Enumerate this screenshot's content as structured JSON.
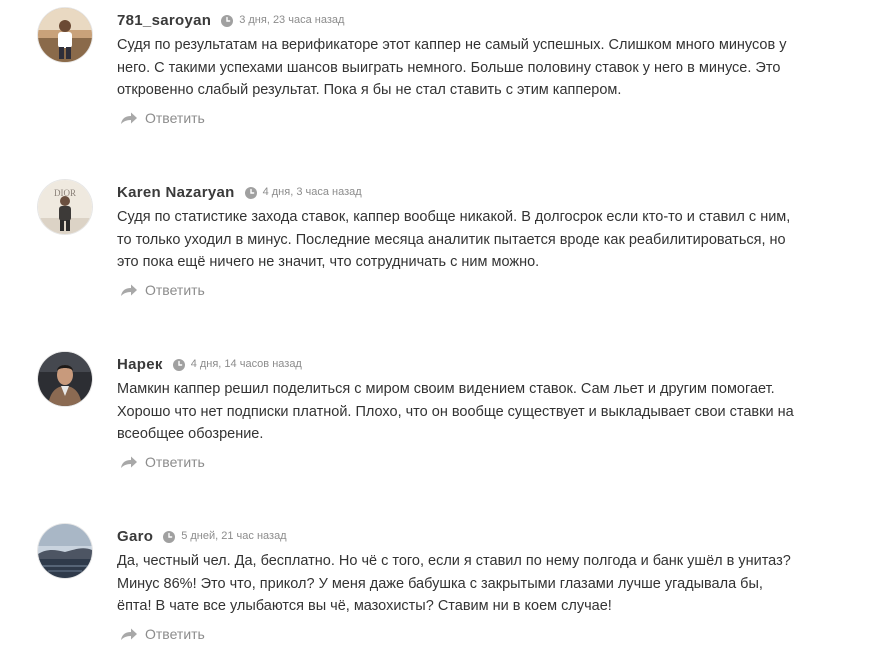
{
  "comments": [
    {
      "author": "781_saroyan",
      "time": "3 дня, 23 часа назад",
      "text": "Судя по результатам на верификаторе этот каппер не самый успешных. Слишком много минусов у него. С такими успехами шансов выиграть немного. Больше половину ставок у него в минусе. Это откровенно слабый результат. Пока я бы не стал ставить с этим каппером.",
      "reply_label": "Ответить"
    },
    {
      "author": "Karen Nazaryan",
      "time": "4 дня, 3 часа назад",
      "text": "Судя по статистике захода ставок, каппер вообще никакой. В долгосрок если кто-то и ставил с ним, то только уходил в минус. Последние месяца аналитик пытается вроде как реабилитироваться, но это пока ещё ничего не значит, что сотрудничать с ним можно.",
      "reply_label": "Ответить"
    },
    {
      "author": "Нарек",
      "time": "4 дня, 14 часов назад",
      "text": "Мамкин каппер решил поделиться с миром своим видением ставок. Сам льет и другим помогает. Хорошо что нет подписки платной. Плохо, что он вообще существует и выкладывает свои ставки на всеобщее обозрение.",
      "reply_label": "Ответить"
    },
    {
      "author": "Garo",
      "time": "5 дней, 21 час назад",
      "text": "Да, честный чел. Да, бесплатно. Но чё с того, если я ставил по нему полгода и банк ушёл в унитаз? Минус 86%! Это что, прикол? У меня даже бабушка с закрытыми глазами лучше угадывала бы, ёпта! В чате все улыбаются вы чё, мазохисты? Ставим ни в коем случае!",
      "reply_label": "Ответить"
    }
  ],
  "icons": {
    "time": "clock-icon",
    "reply": "reply-arrow-icon"
  },
  "colors": {
    "author": "#3a3a3a",
    "meta": "#8c8c8c",
    "text": "#333333"
  }
}
